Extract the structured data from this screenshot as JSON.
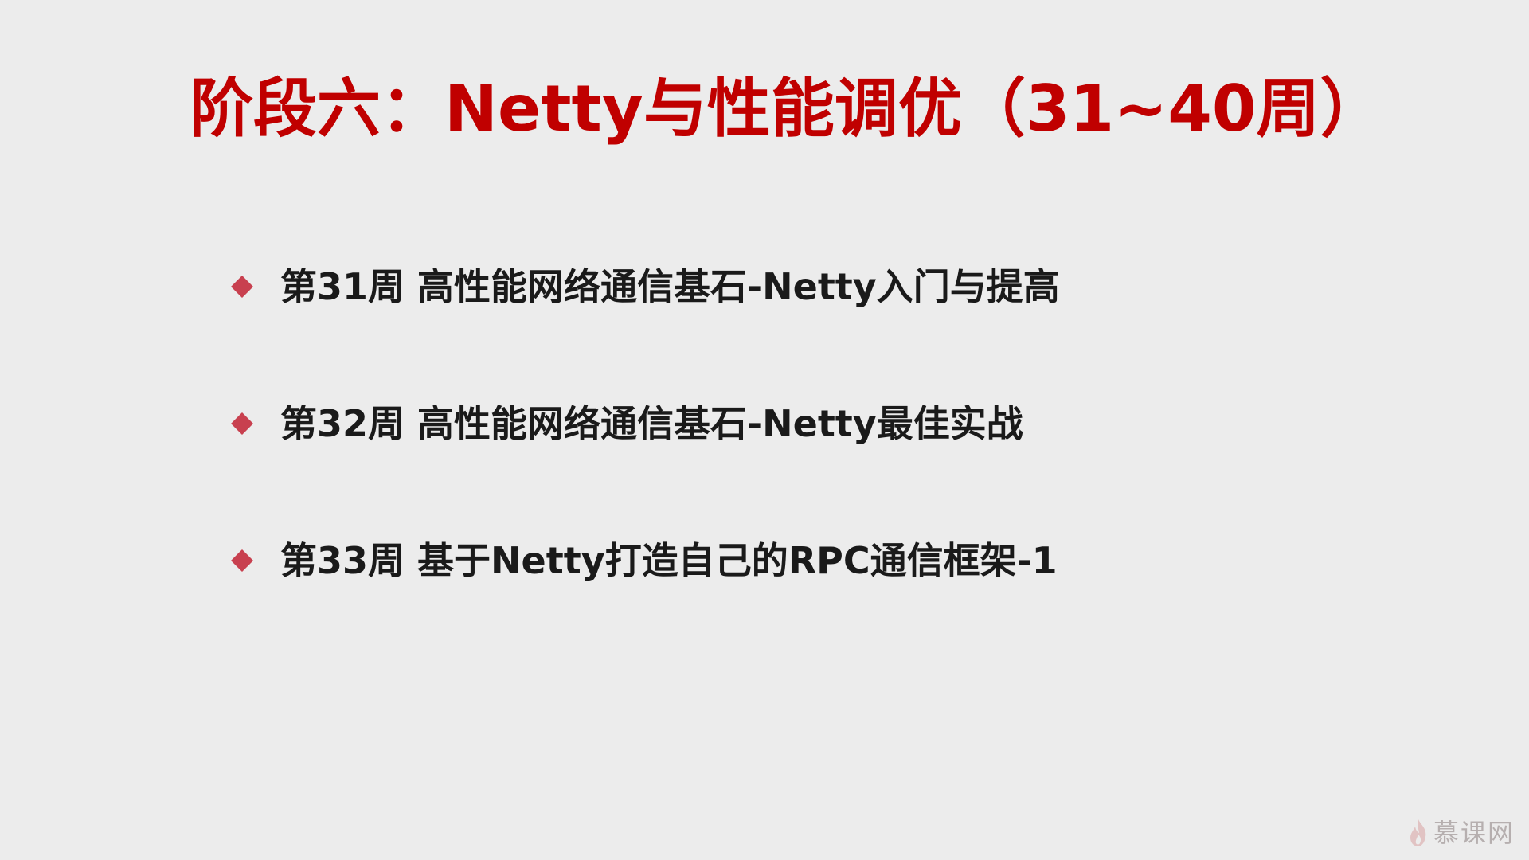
{
  "slide": {
    "title": "阶段六：Netty与性能调优（31~40周）",
    "bullets": [
      {
        "text": "第31周 高性能网络通信基石-Netty入门与提高",
        "icon": "diamond-bullet-icon"
      },
      {
        "text": "第32周 高性能网络通信基石-Netty最佳实战",
        "icon": "diamond-bullet-icon"
      },
      {
        "text": "第33周 基于Netty打造自己的RPC通信框架-1",
        "icon": "diamond-bullet-icon"
      }
    ]
  },
  "watermark": {
    "text": "慕课网",
    "icon": "flame-logo-icon"
  },
  "colors": {
    "background": "#ececec",
    "title": "#c00000",
    "bullet_marker": "#c8404f",
    "body_text": "#1a1a1a"
  }
}
